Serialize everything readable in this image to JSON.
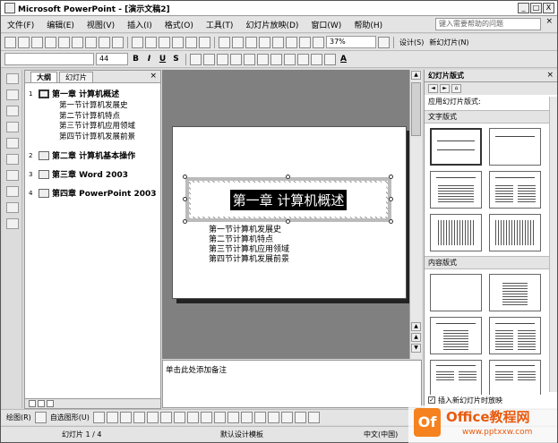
{
  "window": {
    "title": "Microsoft PowerPoint - [演示文稿2]",
    "buttons": [
      "_",
      "□",
      "X"
    ]
  },
  "menu": {
    "items": [
      "文件(F)",
      "编辑(E)",
      "视图(V)",
      "插入(I)",
      "格式(O)",
      "工具(T)",
      "幻灯片放映(D)",
      "窗口(W)",
      "帮助(H)"
    ],
    "help_placeholder": "键入需要帮助的问题",
    "close": "×"
  },
  "toolbar1": {
    "zoom": "37%",
    "design": "设计(S)",
    "new_slide": "新幻灯片(N)"
  },
  "toolbar2": {
    "font_size": "44",
    "bold": "B",
    "italic": "I",
    "underline": "U",
    "shadow": "S",
    "font_color": "A"
  },
  "outline": {
    "tabs": [
      "大纲",
      "幻灯片"
    ],
    "close": "×",
    "slides": [
      {
        "num": "1",
        "title": "第一章 计算机概述",
        "bullets": [
          "第一节计算机发展史",
          "第二节计算机特点",
          "第三节计算机应用领域",
          "第四节计算机发展前景"
        ]
      },
      {
        "num": "2",
        "title": "第二章 计算机基本操作",
        "bullets": []
      },
      {
        "num": "3",
        "title": "第三章 Word 2003",
        "bullets": []
      },
      {
        "num": "4",
        "title": "第四章 PowerPoint 2003",
        "bullets": []
      }
    ]
  },
  "slide": {
    "title": "第一章 计算机概述",
    "bullets": [
      "第一节计算机发展史",
      "第二节计算机特点",
      "第三节计算机应用领域",
      "第四节计算机发展前景"
    ]
  },
  "notes": {
    "placeholder": "单击此处添加备注"
  },
  "taskpane": {
    "title": "幻灯片版式",
    "close": "×",
    "apply_label": "应用幻灯片版式:",
    "sections": [
      "文字版式",
      "内容版式"
    ],
    "insert_checkbox": "插入新幻灯片时放映"
  },
  "drawbar": {
    "draw": "绘图(R)",
    "autoshapes": "自选图形(U)"
  },
  "status": {
    "slide": "幻灯片 1 / 4",
    "template": "默认设计模板",
    "language": "中文(中国)"
  },
  "watermark": {
    "logo": "Of",
    "text1": "Office教程网",
    "text2": "www.pptxxw.com"
  }
}
